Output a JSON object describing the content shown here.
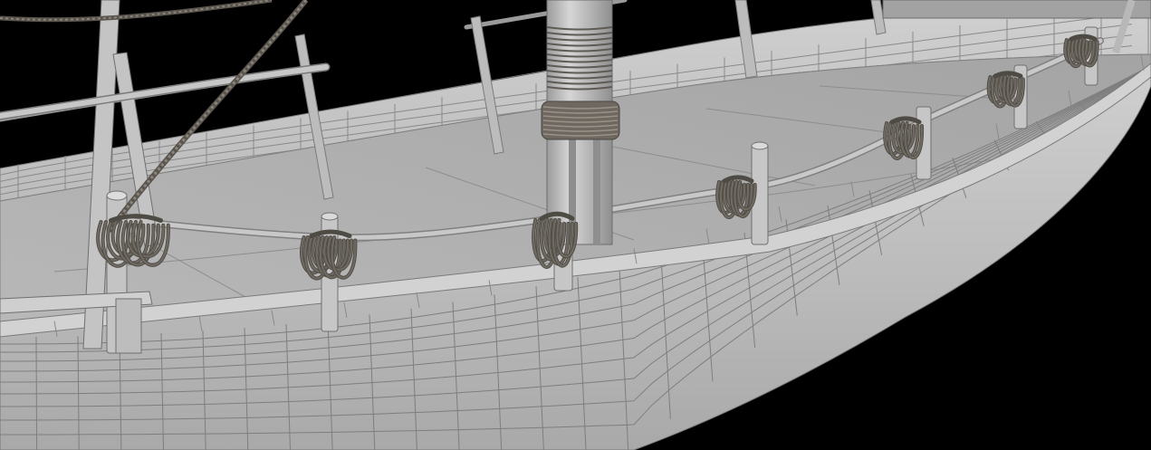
{
  "scene": {
    "subject": "",
    "colors": {
      "background": "#000000",
      "hull_light": "#c9c9c9",
      "hull_mid": "#b4b4b4",
      "hull_dark": "#8e8e8e",
      "deck": "#b2b2b2",
      "deck_far": "#a6a6a6",
      "wire": "#7a7a7a",
      "rail": "#bdbdbd",
      "wood": "#c2c2c2",
      "rope": "#6f6a62",
      "rope_dark": "#4e4a44"
    }
  }
}
